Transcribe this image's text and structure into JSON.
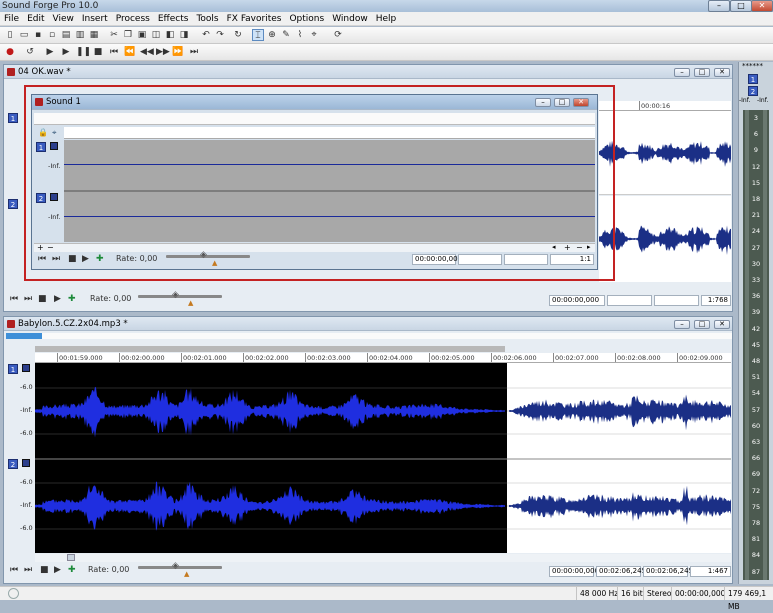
{
  "app": {
    "title": "Sound Forge Pro 10.0"
  },
  "window_controls": {
    "minimize": "–",
    "maximize": "□",
    "close": "✕"
  },
  "menu": [
    "File",
    "Edit",
    "View",
    "Insert",
    "Process",
    "Effects",
    "Tools",
    "FX Favorites",
    "Options",
    "Window",
    "Help"
  ],
  "docs": {
    "ok": {
      "title": "04 OK.wav *",
      "ruler_ticks": [
        "00:00:16"
      ],
      "rate_label": "Rate: 0,00",
      "time": "00:00:00,000",
      "zoom": "1:768",
      "channels": [
        "1",
        "2"
      ]
    },
    "sound1": {
      "title": "Sound 1",
      "levels": [
        "-Inf.",
        "-Inf."
      ],
      "rate_label": "Rate: 0,00",
      "time": "00:00:00,000",
      "zoom": "1:1",
      "channels": [
        "1",
        "2"
      ]
    },
    "babylon": {
      "title": "Babylon.5.CZ.2x04.mp3 *",
      "ruler_ticks": [
        "00:01:59.000",
        "00:02:00.000",
        "00:02:01.000",
        "00:02:02.000",
        "00:02:03.000",
        "00:02:04.000",
        "00:02:05.000",
        "00:02:06.000",
        "00:02:07.000",
        "00:02:08.000",
        "00:02:09.000"
      ],
      "levels_ch1": [
        "-6.0",
        "-Inf.",
        "-6.0"
      ],
      "levels_ch2": [
        "-6.0",
        "-Inf.",
        "-6.0"
      ],
      "rate_label": "Rate: 0,00",
      "time_start": "00:00:00,000",
      "time_end": "00:02:06,245",
      "time_len": "00:02:06,245",
      "zoom": "1:467",
      "channels": [
        "1",
        "2"
      ]
    }
  },
  "meters": {
    "header": "******",
    "channels": [
      "1",
      "2"
    ],
    "inf": "-Inf.",
    "scale": [
      "3",
      "6",
      "9",
      "12",
      "15",
      "18",
      "21",
      "24",
      "27",
      "30",
      "33",
      "36",
      "39",
      "42",
      "45",
      "48",
      "51",
      "54",
      "57",
      "60",
      "63",
      "66",
      "69",
      "72",
      "75",
      "78",
      "81",
      "84",
      "87"
    ]
  },
  "status": {
    "sample_rate": "48 000 Hz",
    "bit_depth": "16 bit",
    "channels": "Stereo",
    "duration": "00:00:00,000",
    "disk_space": "179 469,1 MB"
  },
  "colors": {
    "wave": "#1f2ee0",
    "selection_bg": "#000000",
    "highlight": "#c42222"
  }
}
